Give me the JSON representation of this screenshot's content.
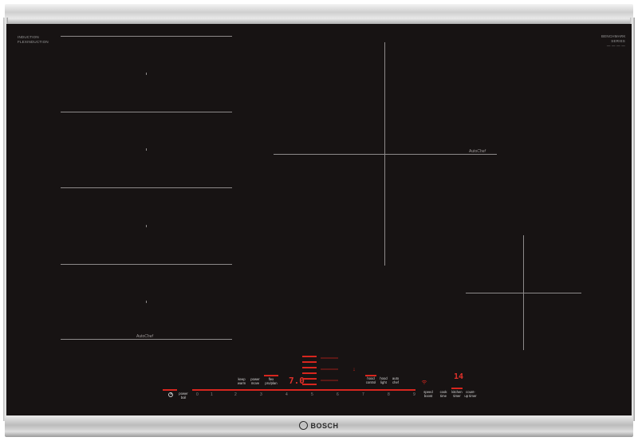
{
  "corner_left": {
    "line1": "INDUCTION",
    "line2": "FLEXINDUCTION"
  },
  "corner_right": {
    "line1": "BENCHMARK",
    "line2": "SERIES",
    "line3": "— — — —"
  },
  "zones": {
    "autochef_left": "AutoChef",
    "autochef_right": "AutoChef",
    "autochef_prefix": "Auto",
    "autochef_suffix": "Chef"
  },
  "controls": {
    "power_label": "power boil",
    "keep_warm": "keep warm",
    "power_move": "power move",
    "flex_pro": "flex pro/plan",
    "hood_control": "hood control",
    "hood_light": "hood light",
    "auto_chef": "auto chef",
    "speed_boost": "speed boost",
    "cookline_timer": "cook time",
    "kitchen_timer": "kitchen timer",
    "count_up_timer": "count-up timer",
    "level_display": "7.0",
    "timer_display": "14",
    "scale": [
      "0",
      "1",
      "2",
      "3",
      "4",
      "5",
      "6",
      "7",
      "8",
      "9"
    ]
  },
  "brand": "BOSCH",
  "colors": {
    "glass": "#171313",
    "indicator_red": "#d7261e"
  }
}
